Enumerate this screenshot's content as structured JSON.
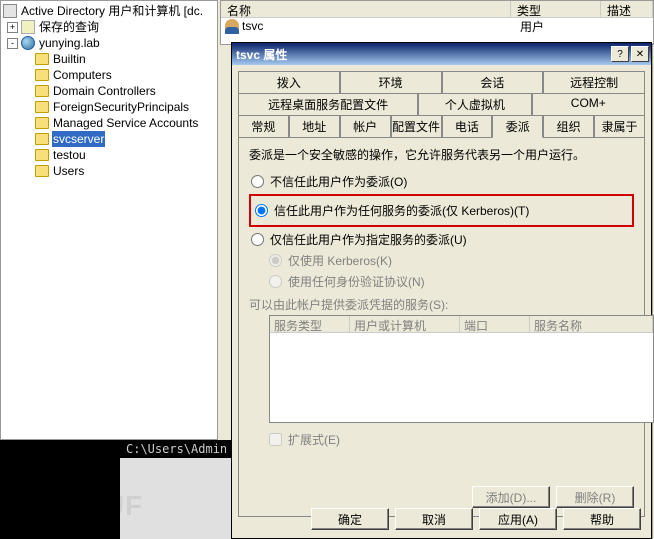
{
  "tree": {
    "root": "Active Directory 用户和计算机 [dc.",
    "saved_queries": "保存的查询",
    "domain": "yunying.lab",
    "children": [
      "Builtin",
      "Computers",
      "Domain Controllers",
      "ForeignSecurityPrincipals",
      "Managed Service Accounts",
      "svcserver",
      "testou",
      "Users"
    ],
    "selected": "svcserver"
  },
  "list": {
    "headers": {
      "name": "名称",
      "type": "类型",
      "desc": "描述"
    },
    "row": {
      "name": "tsvc",
      "type": "用户"
    }
  },
  "cmd_path": "C:\\Users\\Admin",
  "watermark": "FREEBUF",
  "dialog": {
    "title": "tsvc 属性",
    "tabs": {
      "row1": [
        "拨入",
        "环境",
        "会话",
        "远程控制"
      ],
      "row2": [
        "远程桌面服务配置文件",
        "个人虚拟机",
        "COM+"
      ],
      "row3": [
        "常规",
        "地址",
        "帐户",
        "配置文件",
        "电话",
        "委派",
        "组织",
        "隶属于"
      ],
      "active": "委派"
    },
    "delegation": {
      "info": "委派是一个安全敏感的操作，它允许服务代表另一个用户运行。",
      "opt_none": "不信任此用户作为委派(O)",
      "opt_any": "信任此用户作为任何服务的委派(仅 Kerberos)(T)",
      "opt_spec": "仅信任此用户作为指定服务的委派(U)",
      "sub_kerb": "仅使用 Kerberos(K)",
      "sub_any": "使用任何身份验证协议(N)",
      "srv_label": "可以由此帐户提供委派凭据的服务(S):",
      "cols": {
        "type": "服务类型",
        "host": "用户或计算机",
        "port": "端口",
        "name": "服务名称"
      },
      "expanded": "扩展式(E)",
      "add": "添加(D)...",
      "remove": "删除(R)"
    },
    "buttons": {
      "ok": "确定",
      "cancel": "取消",
      "apply": "应用(A)",
      "help": "帮助"
    }
  }
}
